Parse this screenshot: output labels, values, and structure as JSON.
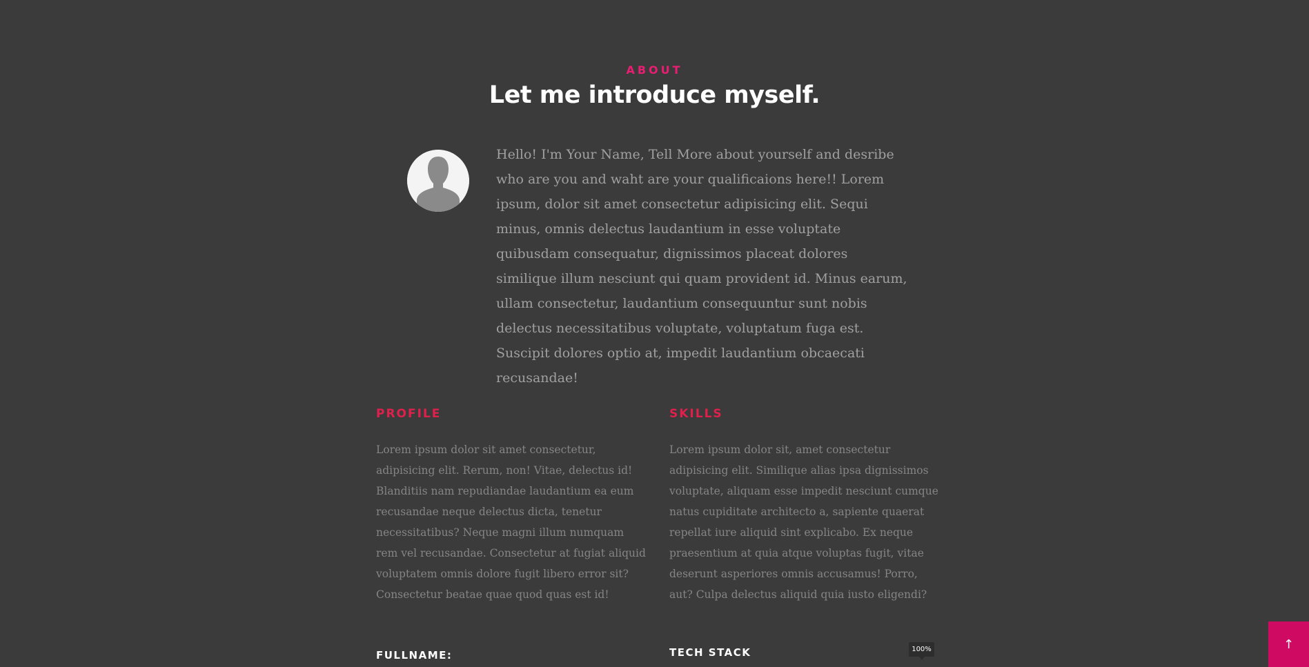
{
  "about": {
    "eyebrow": "ABOUT",
    "title": "Let me introduce myself.",
    "intro": "Hello! I'm Your Name, Tell More about yourself and desribe who are you and waht are your qualificaions here!! Lorem ipsum, dolor sit amet consectetur adipisicing elit. Sequi minus, omnis delectus laudantium in esse voluptate quibusdam consequatur, dignissimos placeat dolores similique illum nesciunt qui quam provident id. Minus earum, ullam consectetur, laudantium consequuntur sunt nobis delectus necessitatibus voluptate, voluptatum fuga est. Suscipit dolores optio at, impedit laudantium obcaecati recusandae!"
  },
  "profile": {
    "heading": "PROFILE",
    "text": "Lorem ipsum dolor sit amet consectetur, adipisicing elit. Rerum, non! Vitae, delectus id! Blanditiis nam repudiandae laudantium ea eum recusandae neque delectus dicta, tenetur necessitatibus? Neque magni illum numquam rem vel recusandae. Consectetur at fugiat aliquid voluptatem omnis dolore fugit libero error sit? Consectetur beatae quae quod quas est id!",
    "subheading": "FULLNAME:"
  },
  "skills": {
    "heading": "SKILLS",
    "text": "Lorem ipsum dolor sit, amet consectetur adipisicing elit. Similique alias ipsa dignissimos voluptate, aliquam esse impedit nesciunt cumque natus cupiditate architecto a, sapiente quaerat repellat iure aliquid sint explicabo. Ex neque praesentium at quia atque voluptas fugit, vitae deserunt asperiores omnis accusamus! Porro, aut? Culpa delectus aliquid quia iusto eligendi?",
    "subheading": "TECH STACK"
  },
  "zoom": {
    "label": "100%"
  },
  "back_to_top": {
    "icon": "arrow-up-icon",
    "glyph": "↑"
  },
  "colors": {
    "background": "#3b3b3b",
    "accent": "#e91e73",
    "heading_red": "#e0204c",
    "button": "#cf0a63"
  }
}
